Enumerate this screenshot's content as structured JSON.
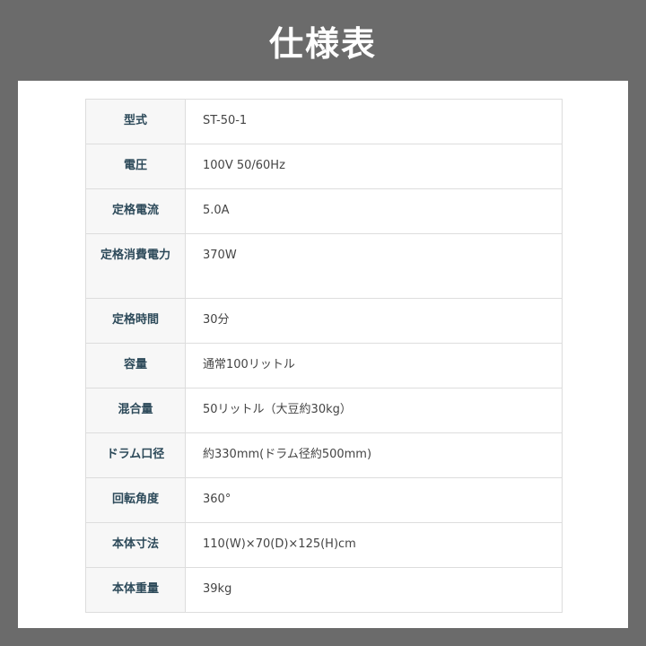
{
  "title": "仕様表",
  "rows": [
    {
      "label": "型式",
      "value": "ST-50-1"
    },
    {
      "label": "電圧",
      "value": "100V 50/60Hz"
    },
    {
      "label": "定格電流",
      "value": "5.0A"
    },
    {
      "label": "定格消費電力",
      "value": "370W"
    },
    {
      "label": "定格時間",
      "value": "30分"
    },
    {
      "label": "容量",
      "value": "通常100リットル"
    },
    {
      "label": "混合量",
      "value": "50リットル（大豆約30kg）"
    },
    {
      "label": "ドラム口径",
      "value": "約330mm(ドラム径約500mm)"
    },
    {
      "label": "回転角度",
      "value": "360°"
    },
    {
      "label": "本体寸法",
      "value": "110(W)×70(D)×125(H)cm"
    },
    {
      "label": "本体重量",
      "value": "39kg"
    }
  ]
}
